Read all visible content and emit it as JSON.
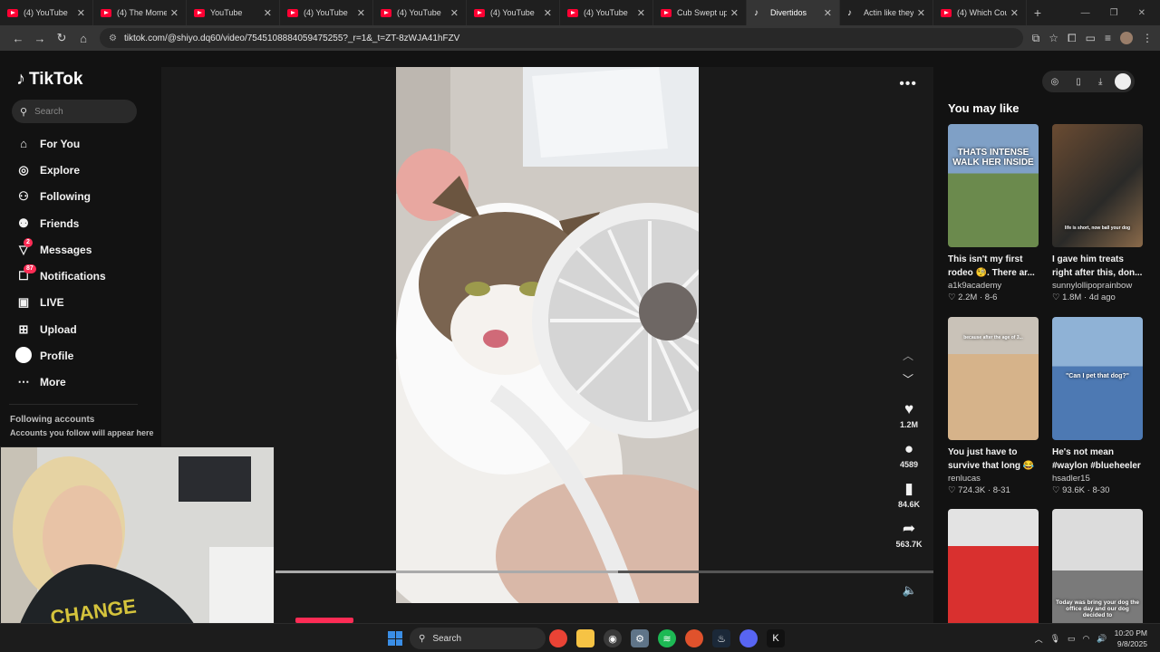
{
  "browser": {
    "tabs": [
      {
        "label": "(4) YouTube",
        "icon": "youtube-icon"
      },
      {
        "label": "(4) The Momen",
        "icon": "youtube-icon"
      },
      {
        "label": "YouTube",
        "icon": "youtube-icon"
      },
      {
        "label": "(4) YouTube",
        "icon": "youtube-icon"
      },
      {
        "label": "(4) YouTube",
        "icon": "youtube-icon"
      },
      {
        "label": "(4) YouTube",
        "icon": "youtube-icon"
      },
      {
        "label": "(4) YouTube",
        "icon": "youtube-icon"
      },
      {
        "label": "Cub Swept up",
        "icon": "youtube-icon"
      },
      {
        "label": "Divertidos",
        "icon": "tiktok-icon",
        "active": true
      },
      {
        "label": "Actin like they",
        "icon": "tiktok-icon"
      },
      {
        "label": "(4) Which Coun",
        "icon": "youtube-icon"
      }
    ],
    "url": "tiktok.com/@shiyo.dq60/video/7545108884059475255?_r=1&_t=ZT-8zWJA41hFZV"
  },
  "sidebar": {
    "logo": "TikTok",
    "search_placeholder": "Search",
    "items": [
      {
        "label": "For You",
        "icon": "home-icon"
      },
      {
        "label": "Explore",
        "icon": "compass-icon"
      },
      {
        "label": "Following",
        "icon": "following-icon"
      },
      {
        "label": "Friends",
        "icon": "friends-icon"
      },
      {
        "label": "Messages",
        "icon": "messages-icon",
        "badge": "2"
      },
      {
        "label": "Notifications",
        "icon": "notifications-icon",
        "badge": "87"
      },
      {
        "label": "LIVE",
        "icon": "live-icon"
      },
      {
        "label": "Upload",
        "icon": "upload-icon"
      },
      {
        "label": "Profile",
        "icon": "profile-icon"
      },
      {
        "label": "More",
        "icon": "more-icon"
      }
    ],
    "following_title": "Following accounts",
    "following_desc": "Accounts you follow will appear here"
  },
  "video": {
    "likes": "1.2M",
    "comments": "4589",
    "bookmarks": "84.6K",
    "shares": "563.7K",
    "progress": 0.52
  },
  "recommendations": {
    "title": "You may like",
    "cards": [
      {
        "title": "This isn't my first rodeo 🧐. There ar...",
        "user": "a1k9academy",
        "likes": "2.2M",
        "date": "8-6",
        "caption": "THATS INTENSE WALK HER INSIDE"
      },
      {
        "title": "I gave him treats right after this, don...",
        "user": "sunnylollipoprainbow",
        "likes": "1.8M",
        "date": "4d ago",
        "caption": "life is short, now ball your dog"
      },
      {
        "title": "You just have to survive that long 😂 ...",
        "user": "renlucas",
        "likes": "724.3K",
        "date": "8-31",
        "caption": "because after the age of 3..."
      },
      {
        "title": "He's not mean #waylon #blueheeler",
        "user": "hsadler15",
        "likes": "93.6K",
        "date": "8-30",
        "caption": "\"Can I pet that dog?\""
      },
      {
        "title": "",
        "user": "",
        "likes": "",
        "date": "",
        "caption": ""
      },
      {
        "title": "",
        "user": "",
        "likes": "",
        "date": "",
        "caption": "Today was bring your dog the office day and our dog decided to"
      }
    ]
  },
  "taskbar": {
    "search": "Search",
    "time": "10:20 PM",
    "date": "9/8/2025"
  },
  "colors": {
    "accent": "#fe2c55",
    "page_bg": "#121212",
    "player_bg": "#1a1a1a"
  }
}
